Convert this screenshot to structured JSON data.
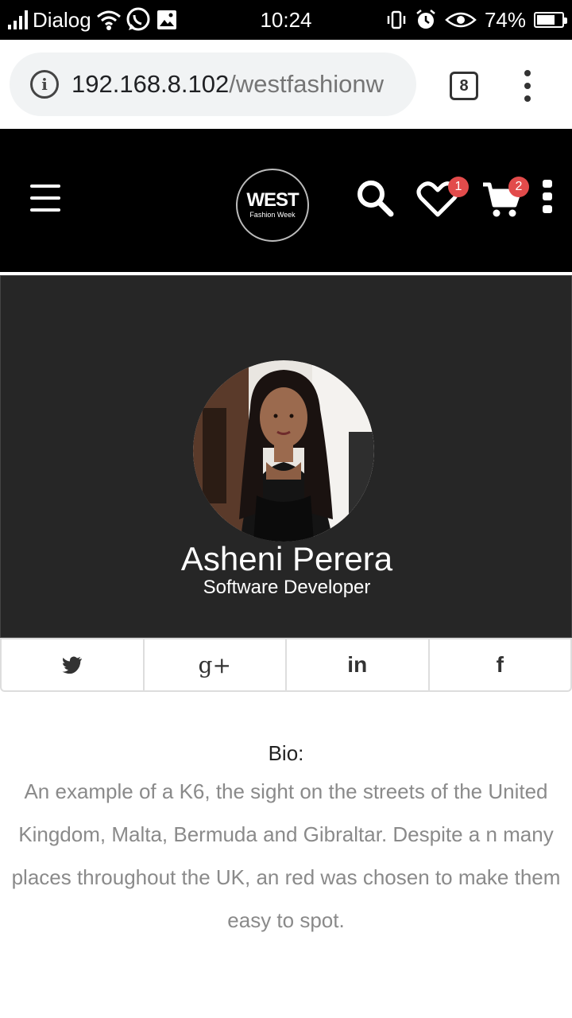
{
  "status_bar": {
    "carrier": "Dialog",
    "time": "10:24",
    "battery": "74%",
    "battery_level": 0.74,
    "icons": [
      "signal-icon",
      "wifi-icon",
      "whatsapp-icon",
      "gallery-icon",
      "vibrate-icon",
      "alarm-icon",
      "eye-icon",
      "battery-icon"
    ]
  },
  "browser": {
    "url_host": "192.168.8.102",
    "url_path": "/westfashionw",
    "tab_count": "8"
  },
  "header": {
    "logo_main": "WEST",
    "logo_sub": "Fashion Week",
    "wishlist_count": "1",
    "cart_count": "2",
    "colors": {
      "background": "#000000",
      "badge": "#e24b4b"
    }
  },
  "profile": {
    "name": "Asheni Perera",
    "role": "Software Developer"
  },
  "social": {
    "items": [
      {
        "icon": "twitter-icon"
      },
      {
        "icon": "google-plus-icon",
        "glyph": "g+"
      },
      {
        "icon": "linkedin-icon",
        "glyph": "in"
      },
      {
        "icon": "facebook-icon",
        "glyph": "f"
      }
    ]
  },
  "bio": {
    "label": "Bio:",
    "text": "An example of a K6, the sight on the streets of the United Kingdom, Malta, Bermuda and Gibraltar. Despite a n many places throughout the UK, an red was chosen to make them easy to spot."
  }
}
